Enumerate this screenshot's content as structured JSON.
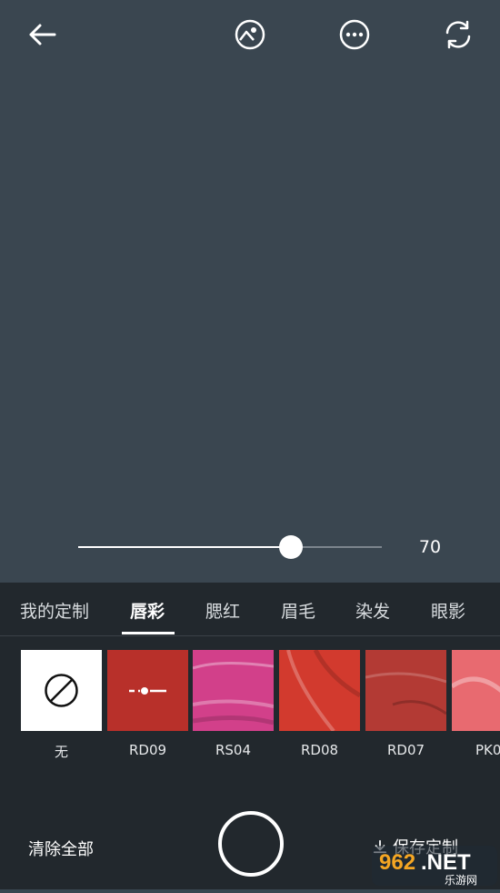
{
  "camera": {
    "slider": {
      "value": 70,
      "max": 100,
      "value_label": "70"
    }
  },
  "tabs": [
    {
      "label": "我的定制",
      "active": false
    },
    {
      "label": "唇彩",
      "active": true
    },
    {
      "label": "腮红",
      "active": false
    },
    {
      "label": "眉毛",
      "active": false
    },
    {
      "label": "染发",
      "active": false
    },
    {
      "label": "眼影",
      "active": false
    }
  ],
  "swatches": [
    {
      "label": "无",
      "color": "#ffffff",
      "type": "none"
    },
    {
      "label": "RD09",
      "color": "#b8302a",
      "type": "selected"
    },
    {
      "label": "RS04",
      "color": "#d2408a",
      "type": "texture"
    },
    {
      "label": "RD08",
      "color": "#d23a2e",
      "type": "texture"
    },
    {
      "label": "RD07",
      "color": "#b33a34",
      "type": "texture"
    },
    {
      "label": "PK0",
      "color": "#e86a70",
      "type": "texture"
    }
  ],
  "bottom": {
    "clear_label": "清除全部",
    "save_label": "保存定制"
  },
  "watermark": {
    "text": "962.NET",
    "subtext": "乐游网"
  }
}
